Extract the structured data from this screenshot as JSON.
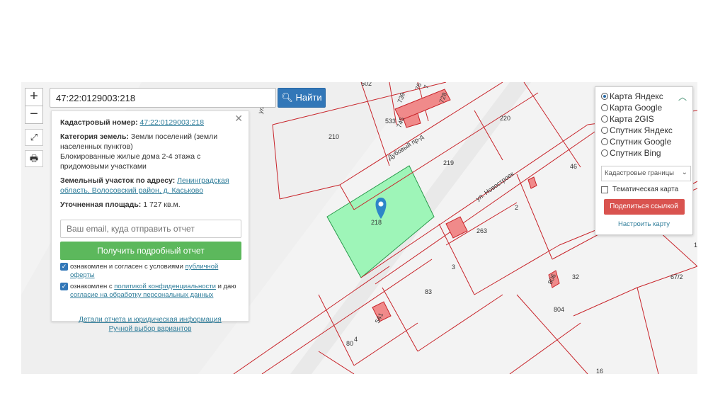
{
  "search": {
    "value": "47:22:0129003:218",
    "button_label": "Найти"
  },
  "zoom": {
    "in": "+",
    "out": "−"
  },
  "info": {
    "cadastral_label": "Кадастровый номер:",
    "cadastral_number": "47:22:0129003:218",
    "category_label": "Категория земель:",
    "category_value": "Земли поселений (земли населенных пунктов)",
    "usage": "Блокированные жилые дома 2-4 этажа с придомовыми участками",
    "address_label": "Земельный участок по адресу:",
    "address_value": "Ленинградская область, Волосовский район, д. Каськово",
    "area_label": "Уточненная площадь:",
    "area_value": "1 727 кв.м.",
    "email_placeholder": "Ваш email, куда отправить отчет",
    "report_button": "Получить подробный отчет",
    "consent1_text": "ознакомлен и согласен с условиями",
    "consent1_link": "публичной оферты",
    "consent2_text": "ознакомлен с",
    "consent2_link": "политикой конфиденциальности",
    "consent2_tail": "и даю",
    "consent2_link2": "согласие на обработку персональных данных",
    "details_link": "Детали отчета и юридическая информация",
    "manual_link": "Ручной выбор вариантов"
  },
  "layers": {
    "options": [
      "Карта Яндекс",
      "Карта Google",
      "Карта 2GIS",
      "Спутник Яндекс",
      "Спутник Google",
      "Спутник Bing"
    ],
    "selected": 0,
    "boundary_select": "Кадастровые границы",
    "thematic": "Тематическая карта",
    "share": "Поделиться ссылкой",
    "configure": "Настроить карту"
  },
  "map": {
    "streets": [
      "Дубовый пр-д",
      "ул. Новостроек",
      "ул."
    ],
    "parcels": [
      "502",
      "739",
      "76",
      "7",
      "728",
      "533",
      "745",
      "210",
      "220",
      "219",
      "46",
      "218",
      "2",
      "263",
      "3",
      "83",
      "32",
      "67/2",
      "1",
      "804",
      "806",
      "80",
      "4",
      "16",
      "541"
    ],
    "colors": {
      "parcel": "#9ef5b8",
      "boundary": "#c8242a",
      "building": "#f08a8a",
      "pin": "#2d86c8"
    }
  }
}
